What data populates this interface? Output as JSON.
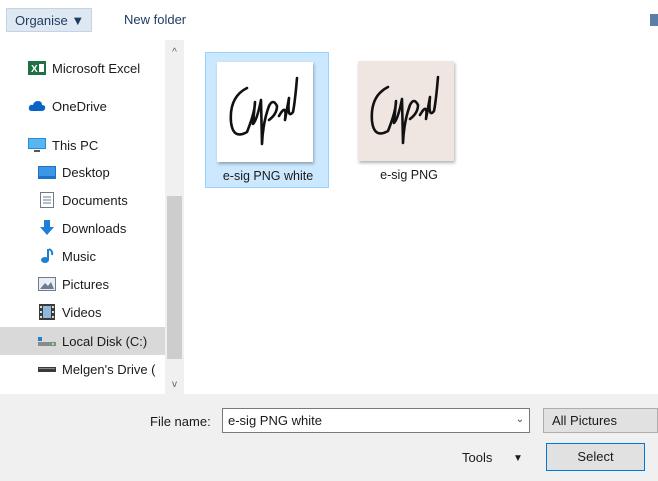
{
  "toolbar": {
    "organise_label": "Organise ▼",
    "new_folder_label": "New folder"
  },
  "sidebar": {
    "items": [
      {
        "label": "Microsoft Excel",
        "icon": "excel-icon"
      },
      {
        "label": "OneDrive",
        "icon": "onedrive-icon"
      },
      {
        "label": "This PC",
        "icon": "monitor-icon"
      },
      {
        "label": "Desktop",
        "icon": "desktop-icon"
      },
      {
        "label": "Documents",
        "icon": "documents-icon"
      },
      {
        "label": "Downloads",
        "icon": "downloads-icon"
      },
      {
        "label": "Music",
        "icon": "music-icon"
      },
      {
        "label": "Pictures",
        "icon": "pictures-icon"
      },
      {
        "label": "Videos",
        "icon": "videos-icon"
      },
      {
        "label": "Local Disk (C:)",
        "icon": "disk-icon"
      },
      {
        "label": "Melgen's Drive (",
        "icon": "drive-icon"
      }
    ]
  },
  "files": [
    {
      "name": "e-sig PNG white",
      "selected": true
    },
    {
      "name": "e-sig PNG",
      "selected": false
    }
  ],
  "footer": {
    "file_name_label": "File name:",
    "file_name_value": "e-sig PNG white",
    "file_type_value": "All Pictures",
    "tools_label": "Tools",
    "select_label": "Select"
  },
  "colors": {
    "selection_bg": "#cce8ff",
    "selection_border": "#99d1ff",
    "primary_border": "#0078d7"
  }
}
